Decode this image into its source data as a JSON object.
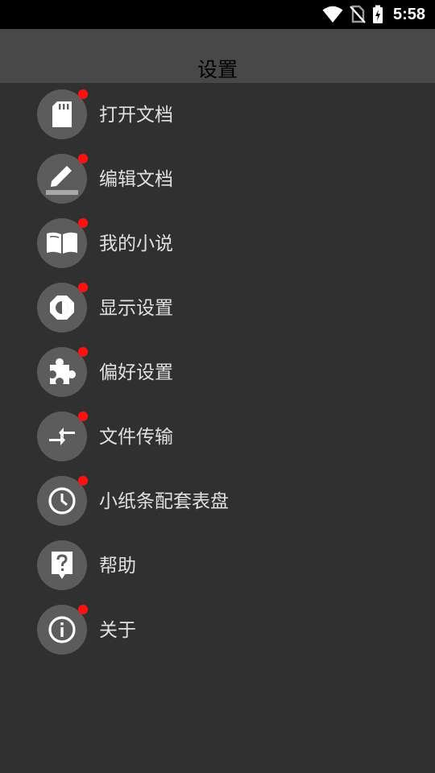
{
  "status_bar": {
    "time": "5:58",
    "icons": [
      "wifi-icon",
      "no-sim-icon",
      "battery-charging-icon"
    ]
  },
  "header": {
    "title": "设置"
  },
  "colors": {
    "background": "#303030",
    "header": "#484848",
    "icon_circle": "#5c5c5c",
    "badge": "#ff1010",
    "label": "#e0e0e0"
  },
  "menu": {
    "items": [
      {
        "label": "打开文档",
        "icon": "sd-card-icon",
        "badge": true
      },
      {
        "label": "编辑文档",
        "icon": "edit-pencil-icon",
        "badge": true
      },
      {
        "label": "我的小说",
        "icon": "open-book-icon",
        "badge": true
      },
      {
        "label": "显示设置",
        "icon": "brightness-icon",
        "badge": true
      },
      {
        "label": "偏好设置",
        "icon": "puzzle-icon",
        "badge": true
      },
      {
        "label": "文件传输",
        "icon": "transfer-arrows-icon",
        "badge": true
      },
      {
        "label": "小纸条配套表盘",
        "icon": "clock-icon",
        "badge": true
      },
      {
        "label": "帮助",
        "icon": "help-icon",
        "badge": false
      },
      {
        "label": "关于",
        "icon": "info-icon",
        "badge": true
      }
    ]
  }
}
